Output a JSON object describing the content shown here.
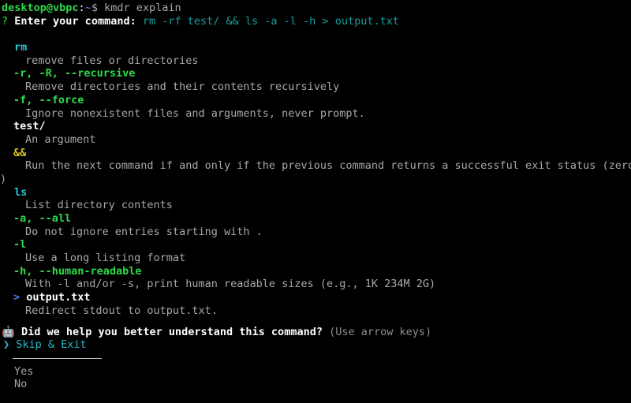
{
  "terminal": {
    "background": "#000000",
    "prompt": {
      "user_host": "desktop@vbpc",
      "colon": ":",
      "path": "~",
      "dollar": "$",
      "command_typed": " kmdr explain"
    },
    "question_line": {
      "marker": "?",
      "label": "Enter your command:",
      "value": "rm -rf test/ && ls -a -l -h > output.txt"
    }
  },
  "explanation": [
    {
      "token": "rm",
      "token_style": "program",
      "description": "remove files or directories"
    },
    {
      "token": "-r, -R, --recursive",
      "token_style": "option",
      "description": "Remove directories and their contents recursively"
    },
    {
      "token": "-f, --force",
      "token_style": "option",
      "description": "Ignore nonexistent files and arguments, never prompt."
    },
    {
      "token": "test/",
      "token_style": "argument",
      "description": "An argument"
    },
    {
      "token": "&&",
      "token_style": "operator",
      "description": "Run the next command if and only if the previous command returns a successful exit status (zero",
      "description_wrap": ")"
    },
    {
      "token": "ls",
      "token_style": "program",
      "description": "List directory contents"
    },
    {
      "token": "-a, --all",
      "token_style": "option",
      "description": "Do not ignore entries starting with ."
    },
    {
      "token": "-l",
      "token_style": "option",
      "description": "Use a long listing format"
    },
    {
      "token": "-h, --human-readable",
      "token_style": "option",
      "description": "With -l and/or -s, print human readable sizes (e.g., 1K 234M 2G)"
    },
    {
      "token_prefix": ">",
      "token": "output.txt",
      "token_style": "redirect",
      "description": "Redirect stdout to output.txt."
    }
  ],
  "survey": {
    "icon": "robot-icon",
    "icon_glyph": "🤖",
    "question": "Did we help you better understand this command?",
    "hint": "(Use arrow keys)",
    "pointer": "❯",
    "selected_option": "Skip & Exit",
    "options": [
      {
        "label": "Skip & Exit",
        "selected": true
      },
      {
        "label": "Yes",
        "selected": false
      },
      {
        "label": "No",
        "selected": false
      }
    ]
  },
  "colors": {
    "program": "#29c5d6",
    "option": "#2fd94a",
    "argument": "#ffffff",
    "operator": "#d6c02b",
    "redirect": "#4f7ce8",
    "command_echo": "#1a9e9e",
    "description": "#a8a8a8",
    "selection": "#29b8c6"
  }
}
